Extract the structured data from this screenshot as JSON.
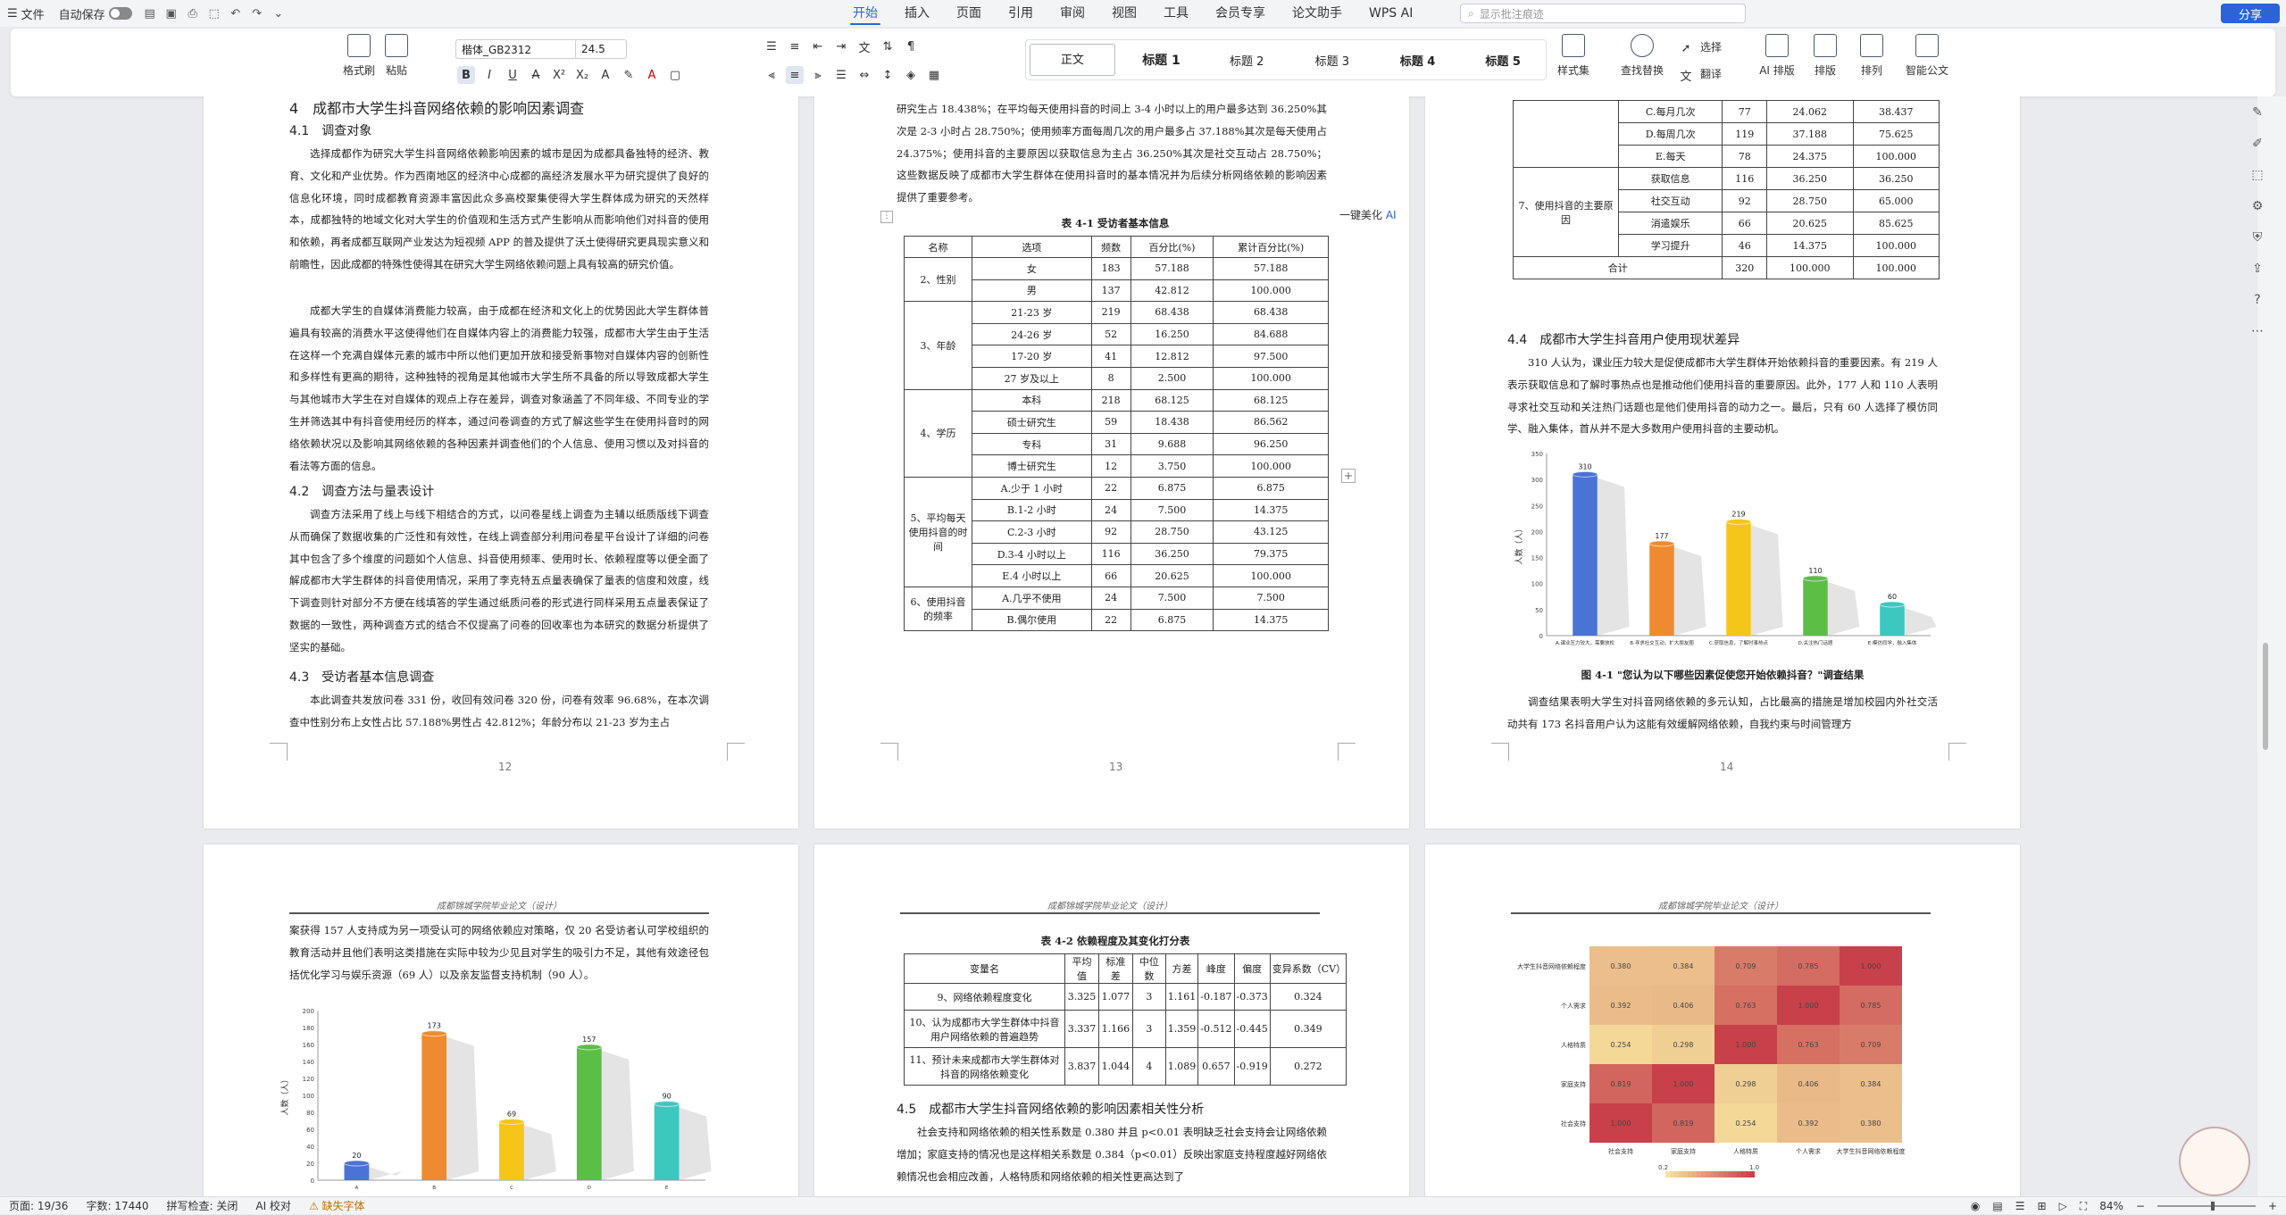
{
  "titlebar": {
    "file": "文件",
    "autosave": "自动保存",
    "tabs": [
      "开始",
      "插入",
      "页面",
      "引用",
      "审阅",
      "视图",
      "工具",
      "会员专享",
      "论文助手",
      "WPS AI"
    ],
    "active_tab": "开始",
    "search_placeholder": "显示批注痕迹",
    "share": "分享"
  },
  "ribbon": {
    "format_painter": "格式刷",
    "paste": "粘贴",
    "font": "楷体_GB2312",
    "size": "24.5",
    "styles": [
      "正文",
      "标题 1",
      "标题 2",
      "标题 3",
      "标题 4",
      "标题 5"
    ],
    "style_set": "样式集",
    "find_replace": "查找替换",
    "select": "选择",
    "translate": "翻译",
    "ai_layout": "AI 排版",
    "layout": "排版",
    "arrange": "排列",
    "smart_doc": "智能公文"
  },
  "page12": {
    "h_chapter": "4　成都市大学生抖音网络依赖的影响因素调查",
    "h41": "4.1　调查对象",
    "p1": "选择成都作为研究大学生抖音网络依赖影响因素的城市是因为成都具备独特的经济、教育、文化和产业优势。作为西南地区的经济中心成都的高经济发展水平为研究提供了良好的信息化环境，同时成都教育资源丰富因此众多高校聚集使得大学生群体成为研究的天然样本，成都独特的地域文化对大学生的价值观和生活方式产生影响从而影响他们对抖音的使用和依赖，再者成都互联网产业发达为短视频 APP 的普及提供了沃土使得研究更具现实意义和前瞻性，因此成都的特殊性使得其在研究大学生网络依赖问题上具有较高的研究价值。",
    "p2": "成都大学生的自媒体消费能力较高，由于成都在经济和文化上的优势因此大学生群体普遍具有较高的消费水平这使得他们在自媒体内容上的消费能力较强，成都市大学生由于生活在这样一个充满自媒体元素的城市中所以他们更加开放和接受新事物对自媒体内容的创新性和多样性有更高的期待，这种独特的视角是其他城市大学生所不具备的所以导致成都大学生与其他城市大学生在对自媒体的观点上存在差异，调查对象涵盖了不同年级、不同专业的学生并筛选其中有抖音使用经历的样本，通过问卷调查的方式了解这些学生在使用抖音时的网络依赖状况以及影响其网络依赖的各种因素并调查他们的个人信息、使用习惯以及对抖音的看法等方面的信息。",
    "h42": "4.2　调查方法与量表设计",
    "p3": "调查方法采用了线上与线下相结合的方式，以问卷星线上调查为主辅以纸质版线下调查从而确保了数据收集的广泛性和有效性，在线上调查部分利用问卷星平台设计了详细的问卷其中包含了多个维度的问题如个人信息、抖音使用频率、使用时长、依赖程度等以便全面了解成都市大学生群体的抖音使用情况，采用了李克特五点量表确保了量表的信度和效度，线下调查则针对部分不方便在线填答的学生通过纸质问卷的形式进行同样采用五点量表保证了数据的一致性，两种调查方式的结合不仅提高了问卷的回收率也为本研究的数据分析提供了坚实的基础。",
    "h43": "4.3　受访者基本信息调查",
    "p4": "本此调查共发放问卷 331 份，收回有效问卷 320 份，问卷有效率 96.68%，在本次调查中性别分布上女性占比 57.188%男性占 42.812%；年龄分布以 21-23 岁为主占",
    "num": "12"
  },
  "page13": {
    "p_top": "研究生占 18.438%；在平均每天使用抖音的时间上 3-4 小时以上的用户最多达到 36.250%其次是 2-3 小时占 28.750%；使用频率方面每周几次的用户最多占 37.188%其次是每天使用占 24.375%；使用抖音的主要原因以获取信息为主占 36.250%其次是社交互动占 28.750%；这些数据反映了成都市大学生群体在使用抖音时的基本情况并为后续分析网络依赖的影响因素提供了重要参考。",
    "caption": "表 4-1  受访者基本信息",
    "beautify": "一键美化",
    "headers": [
      "名称",
      "选项",
      "频数",
      "百分比(%)",
      "累计百分比(%)"
    ],
    "groups": [
      {
        "name": "2、性别",
        "rows": [
          [
            "女",
            "183",
            "57.188",
            "57.188"
          ],
          [
            "男",
            "137",
            "42.812",
            "100.000"
          ]
        ]
      },
      {
        "name": "3、年龄",
        "rows": [
          [
            "21-23 岁",
            "219",
            "68.438",
            "68.438"
          ],
          [
            "24-26 岁",
            "52",
            "16.250",
            "84.688"
          ],
          [
            "17-20 岁",
            "41",
            "12.812",
            "97.500"
          ],
          [
            "27 岁及以上",
            "8",
            "2.500",
            "100.000"
          ]
        ]
      },
      {
        "name": "4、学历",
        "rows": [
          [
            "本科",
            "218",
            "68.125",
            "68.125"
          ],
          [
            "硕士研究生",
            "59",
            "18.438",
            "86.562"
          ],
          [
            "专科",
            "31",
            "9.688",
            "96.250"
          ],
          [
            "博士研究生",
            "12",
            "3.750",
            "100.000"
          ]
        ]
      },
      {
        "name": "5、平均每天使用抖音的时间",
        "rows": [
          [
            "A.少于 1 小时",
            "22",
            "6.875",
            "6.875"
          ],
          [
            "B.1-2 小时",
            "24",
            "7.500",
            "14.375"
          ],
          [
            "C.2-3 小时",
            "92",
            "28.750",
            "43.125"
          ],
          [
            "D.3-4 小时以上",
            "116",
            "36.250",
            "79.375"
          ],
          [
            "E.4 小时以上",
            "66",
            "20.625",
            "100.000"
          ]
        ]
      },
      {
        "name": "6、使用抖音的频率",
        "rows": [
          [
            "A.几乎不使用",
            "24",
            "7.500",
            "7.500"
          ],
          [
            "B.偶尔使用",
            "22",
            "6.875",
            "14.375"
          ]
        ]
      }
    ],
    "num": "13"
  },
  "page14": {
    "rows_top": [
      [
        "C.每月几次",
        "77",
        "24.062",
        "38.437"
      ],
      [
        "D.每周几次",
        "119",
        "37.188",
        "75.625"
      ],
      [
        "E.每天",
        "78",
        "24.375",
        "100.000"
      ]
    ],
    "group7": {
      "name": "7、使用抖音的主要原因",
      "rows": [
        [
          "获取信息",
          "116",
          "36.250",
          "36.250"
        ],
        [
          "社交互动",
          "92",
          "28.750",
          "65.000"
        ],
        [
          "消遣娱乐",
          "66",
          "20.625",
          "85.625"
        ],
        [
          "学习提升",
          "46",
          "14.375",
          "100.000"
        ]
      ]
    },
    "total": [
      "合计",
      "320",
      "100.000",
      "100.000"
    ],
    "h44": "4.4　成都市大学生抖音用户使用现状差异",
    "p1": "310 人认为，课业压力较大是促使成都市大学生群体开始依赖抖音的重要因素。有 219 人表示获取信息和了解时事热点也是推动他们使用抖音的重要原因。此外，177 人和 110 人表明寻求社交互动和关注热门话题也是他们使用抖音的动力之一。最后，只有 60 人选择了模仿同学、融入集体，首从并不是大多数用户使用抖音的主要动机。",
    "fig_caption": "图 4-1  \"您认为以下哪些因素促使您开始依赖抖音？\"调查结果",
    "p2": "调查结果表明大学生对抖音网络依赖的多元认知，占比最高的措施是增加校园内外社交活动共有 173 名抖音用户认为这能有效缓解网络依赖，自我约束与时间管理方",
    "num": "14"
  },
  "page15": {
    "header": "成都锦城学院毕业论文（设计）",
    "p1": "案获得 157 人支持成为另一项受认可的网络依赖应对策略，仅 20 名受访者认可学校组织的教育活动并且他们表明这类措施在实际中较为少见且对学生的吸引力不足，其他有效途径包括优化学习与娱乐资源（69 人）以及亲友监督支持机制（90 人）。"
  },
  "page16": {
    "header": "成都锦城学院毕业论文（设计）",
    "caption": "表 4-2  依赖程度及其变化打分表",
    "headers": [
      "变量名",
      "平均值",
      "标准差",
      "中位数",
      "方差",
      "峰度",
      "偏度",
      "变异系数（CV）"
    ],
    "rows": [
      [
        "9、网络依赖程度变化",
        "3.325",
        "1.077",
        "3",
        "1.161",
        "-0.187",
        "-0.373",
        "0.324"
      ],
      [
        "10、认为成都市大学生群体中抖音用户网络依赖的普遍趋势",
        "3.337",
        "1.166",
        "3",
        "1.359",
        "-0.512",
        "-0.445",
        "0.349"
      ],
      [
        "11、预计未来成都市大学生群体对抖音的网络依赖变化",
        "3.837",
        "1.044",
        "4",
        "1.089",
        "0.657",
        "-0.919",
        "0.272"
      ]
    ],
    "h45": "4.5　成都市大学生抖音网络依赖的影响因素相关性分析",
    "p1": "社会支持和网络依赖的相关性系数是 0.380 并且 p<0.01 表明缺乏社会支持会让网络依赖增加；家庭支持的情况也是这样相关系数是 0.384（p<0.01）反映出家庭支持程度越好网络依赖情况也会相应改善，人格特质和网络依赖的相关性更高达到了"
  },
  "page17": {
    "header": "成都锦城学院毕业论文（设计）"
  },
  "chart_data": [
    {
      "type": "bar",
      "ylabel": "人数（人）",
      "categories": [
        "A.课业压力较大，需要放松",
        "B.寻求社交互动，扩大朋友圈",
        "C.获取信息，了解时事热点",
        "D.关注热门话题",
        "E.模仿同学，融入集体"
      ],
      "values": [
        310,
        177,
        219,
        110,
        60
      ],
      "ylim": [
        0,
        350
      ],
      "yticks": [
        0,
        50,
        100,
        150,
        200,
        250,
        300,
        350
      ],
      "colors": [
        "#4a73d6",
        "#f08a30",
        "#f5c518",
        "#5bbf45",
        "#3cc8c0"
      ]
    },
    {
      "type": "bar",
      "ylabel": "人数（人）",
      "categories": [
        "A",
        "B",
        "C",
        "D",
        "E"
      ],
      "values": [
        20,
        173,
        69,
        157,
        90
      ],
      "ylim": [
        0,
        200
      ],
      "yticks": [
        0,
        20,
        40,
        60,
        80,
        100,
        120,
        140,
        160,
        180,
        200
      ],
      "colors": [
        "#4a73d6",
        "#f08a30",
        "#f5c518",
        "#5bbf45",
        "#3cc8c0"
      ]
    },
    {
      "type": "heatmap",
      "rows": [
        "大学生抖音网络依赖程度",
        "个人需求",
        "人格特质",
        "家庭支持",
        "社会支持"
      ],
      "cols": [
        "社会支持",
        "家庭支持",
        "人格特质",
        "个人需求",
        "大学生抖音网络依赖程度"
      ],
      "values": [
        [
          0.38,
          0.384,
          0.709,
          0.785,
          1.0
        ],
        [
          0.392,
          0.406,
          0.763,
          1.0,
          0.785
        ],
        [
          0.254,
          0.298,
          1.0,
          0.763,
          0.709
        ],
        [
          0.819,
          1.0,
          0.298,
          0.406,
          0.384
        ],
        [
          1.0,
          0.819,
          0.254,
          0.392,
          0.38
        ]
      ],
      "legend_ticks": [
        "0.2",
        "1.0"
      ]
    }
  ],
  "status": {
    "page": "页面: 19/36",
    "words": "字数: 17440",
    "spell": "拼写检查: 关闭",
    "ai_check": "AI 校对",
    "missing_font": "缺失字体",
    "zoom": "84%"
  }
}
